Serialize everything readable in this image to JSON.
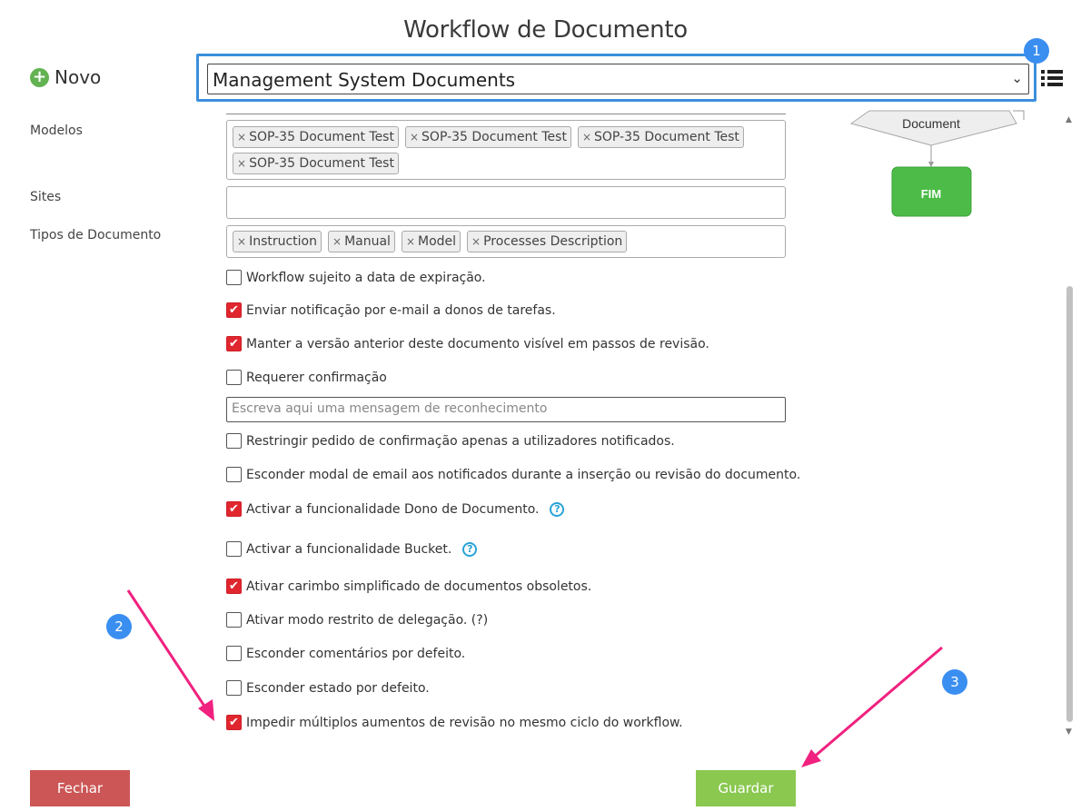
{
  "header": {
    "title": "Workflow de Documento",
    "new_label": "Novo"
  },
  "workflow_select": {
    "value": "Management System Documents"
  },
  "badges": [
    "1",
    "2",
    "3"
  ],
  "fields": {
    "models": {
      "label": "Modelos",
      "tags": [
        "SOP-35 Document Test",
        "SOP-35 Document Test",
        "SOP-35 Document Test",
        "SOP-35 Document Test"
      ]
    },
    "sites": {
      "label": "Sites"
    },
    "doc_types": {
      "label": "Tipos de Documento",
      "tags": [
        "Instruction",
        "Manual",
        "Model",
        "Processes Description"
      ]
    }
  },
  "checkboxes": [
    {
      "label": "Workflow sujeito a data de expiração.",
      "checked": false
    },
    {
      "label": "Enviar notificação por e-mail a donos de tarefas.",
      "checked": true
    },
    {
      "label": "Manter a versão anterior deste documento visível em passos de revisão.",
      "checked": true
    },
    {
      "label": "Requerer confirmação",
      "checked": false
    },
    {
      "label": "Restringir pedido de confirmação apenas a utilizadores notificados.",
      "checked": false
    },
    {
      "label": "Esconder modal de email aos notificados durante a inserção ou revisão do documento.",
      "checked": false
    },
    {
      "label": "Activar a funcionalidade Dono de Documento.",
      "checked": true,
      "help": true
    },
    {
      "label": "Activar a funcionalidade Bucket.",
      "checked": false,
      "help": true
    },
    {
      "label": "Ativar carimbo simplificado de documentos obsoletos.",
      "checked": true
    },
    {
      "label": "Ativar modo restrito de delegação. (?)",
      "checked": false
    },
    {
      "label": "Esconder comentários por defeito.",
      "checked": false
    },
    {
      "label": "Esconder estado por defeito.",
      "checked": false
    },
    {
      "label": "Impedir múltiplos aumentos de revisão no mesmo ciclo do workflow.",
      "checked": true
    }
  ],
  "ack_input": {
    "placeholder": "Escreva aqui uma mensagem de reconhecimento"
  },
  "diagram": {
    "node_label": "Document",
    "end_label": "FIM"
  },
  "buttons": {
    "close": "Fechar",
    "save": "Guardar"
  },
  "colors": {
    "accent": "#3b8fdc",
    "checked": "#e0262e",
    "save": "#8ac850",
    "close": "#cc5656",
    "end_node": "#4cbb47",
    "annotation_arrow": "#f0217f"
  }
}
